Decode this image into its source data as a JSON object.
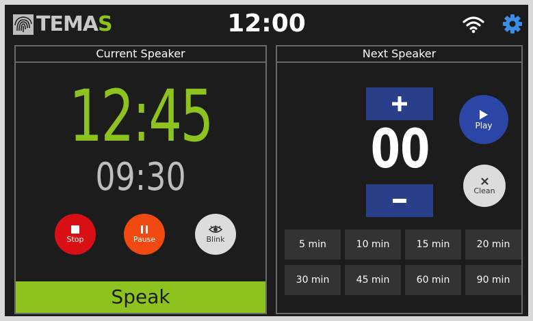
{
  "header": {
    "logo_prefix": "TEMA",
    "logo_accent": "S",
    "clock": "12:00",
    "icons": [
      "wifi-icon",
      "gear-icon"
    ]
  },
  "current": {
    "title": "Current Speaker",
    "time": "12:45",
    "sub_time": "09:30",
    "stop_label": "Stop",
    "pause_label": "Pause",
    "blink_label": "Blink",
    "speak_label": "Speak"
  },
  "next": {
    "title": "Next Speaker",
    "value": "00",
    "plus_label": "+",
    "minus_label": "–",
    "play_label": "Play",
    "clean_label": "Clean",
    "presets": [
      "5 min",
      "10 min",
      "15 min",
      "20 min",
      "30 min",
      "45 min",
      "60 min",
      "90 min"
    ]
  },
  "colors": {
    "accent_green": "#8dc21f",
    "stop_red": "#d90f16",
    "pause_orange": "#f04a12",
    "play_blue": "#2c46a8",
    "step_blue": "#2a3f8a",
    "settings_blue": "#3a8ee6"
  }
}
